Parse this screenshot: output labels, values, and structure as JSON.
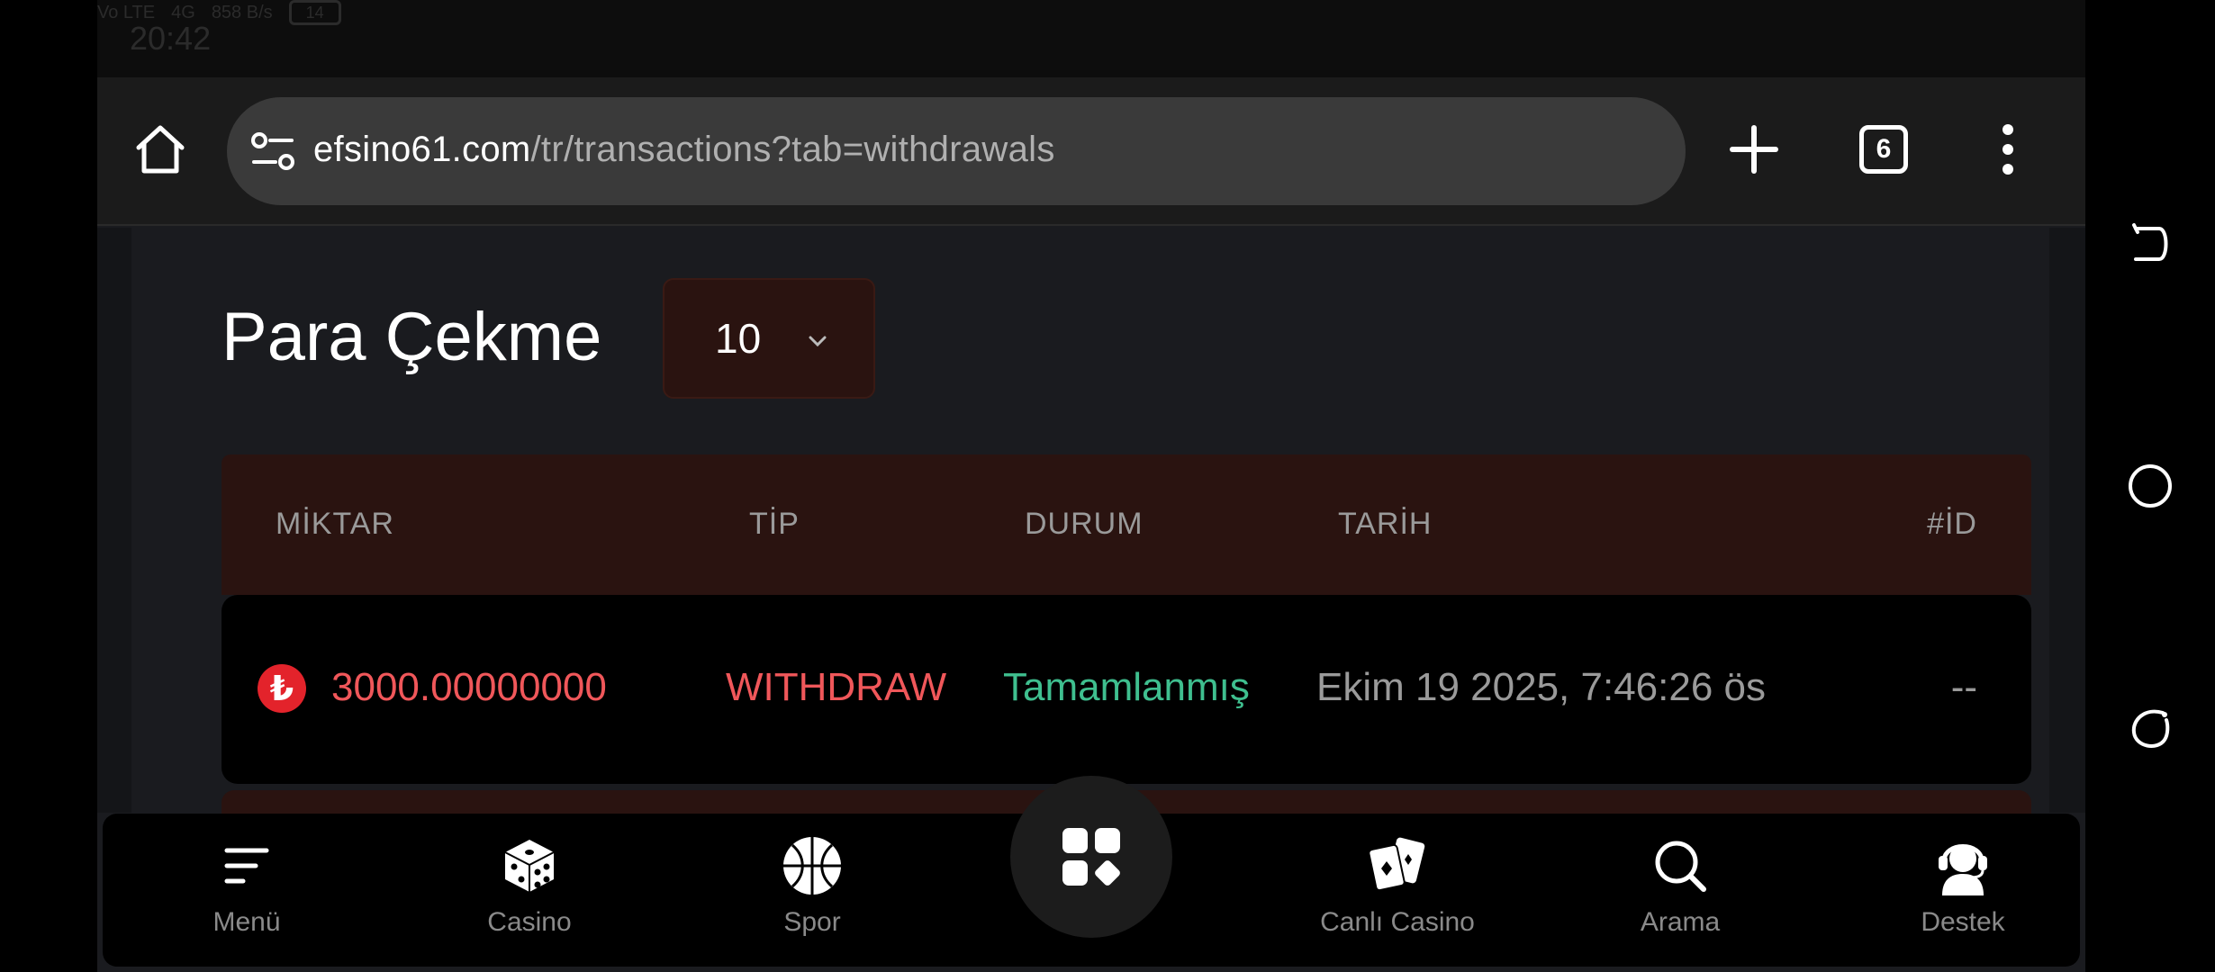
{
  "status_bar": {
    "time": "20:42",
    "volte": "Vo LTE",
    "network": "4G",
    "speed": "858 B/s",
    "battery": "14"
  },
  "browser": {
    "url_domain": "efsino61.com",
    "url_path": "/tr/transactions?tab=withdrawals",
    "tab_count": "6"
  },
  "page": {
    "title": "Para Çekme",
    "page_size": "10"
  },
  "table": {
    "headers": {
      "amount": "MİKTAR",
      "type": "TİP",
      "status": "DURUM",
      "date": "TARİH",
      "id": "#İD"
    },
    "rows": [
      {
        "currency_symbol": "₺",
        "amount": "3000.00000000",
        "type": "WITHDRAW",
        "status": "Tamamlanmış",
        "date": "Ekim 19 2025, 7:46:26 ös",
        "id": "--"
      }
    ]
  },
  "bottom_nav": {
    "menu": "Menü",
    "casino": "Casino",
    "sports": "Spor",
    "live_casino": "Canlı Casino",
    "search": "Arama",
    "support": "Destek"
  },
  "colors": {
    "accent_red": "#e3232b",
    "amount_red": "#f0575a",
    "status_green": "#3fbf8f",
    "header_bg": "#2a1310"
  }
}
